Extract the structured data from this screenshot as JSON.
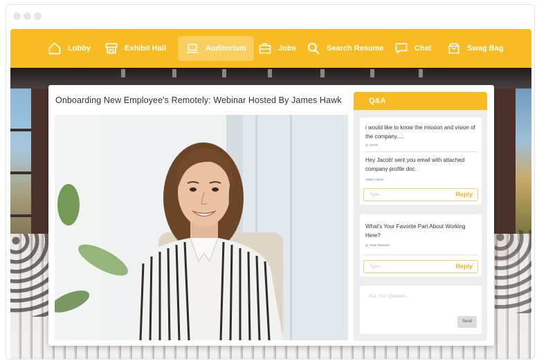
{
  "nav": {
    "items": [
      {
        "label": "Lobby",
        "icon": "home-icon"
      },
      {
        "label": "Exhibit Hall",
        "icon": "booth-icon"
      },
      {
        "label": "Auditorium",
        "icon": "laptop-icon",
        "active": true
      },
      {
        "label": "Jobs",
        "icon": "briefcase-icon"
      },
      {
        "label": "Search Resume",
        "icon": "search-icon"
      },
      {
        "label": "Chat",
        "icon": "chat-icon"
      },
      {
        "label": "Swag Bag",
        "icon": "bag-icon"
      }
    ]
  },
  "webinar": {
    "title": "Onboarding New Employee's Remotely: Webinar Hosted By James Hawk"
  },
  "qa": {
    "heading": "Q&A",
    "threads": [
      {
        "question": "i would like to know the mission and vision of the company.....",
        "question_author": "Q: Jacob",
        "answer": "Hey Jacob! sent you email with attached company profile doc.",
        "answer_author": "Admin Admin",
        "reply_placeholder": "Type...",
        "reply_label": "Reply"
      },
      {
        "question": "What's Your Favorite Part About Working Here?",
        "question_author": "Q: Hank Reardon",
        "reply_placeholder": "Type...",
        "reply_label": "Reply"
      }
    ],
    "ask_placeholder": "Ask Your Question...",
    "send_label": "Send"
  },
  "colors": {
    "accent": "#f8bb22",
    "reply": "#f2b21c"
  }
}
